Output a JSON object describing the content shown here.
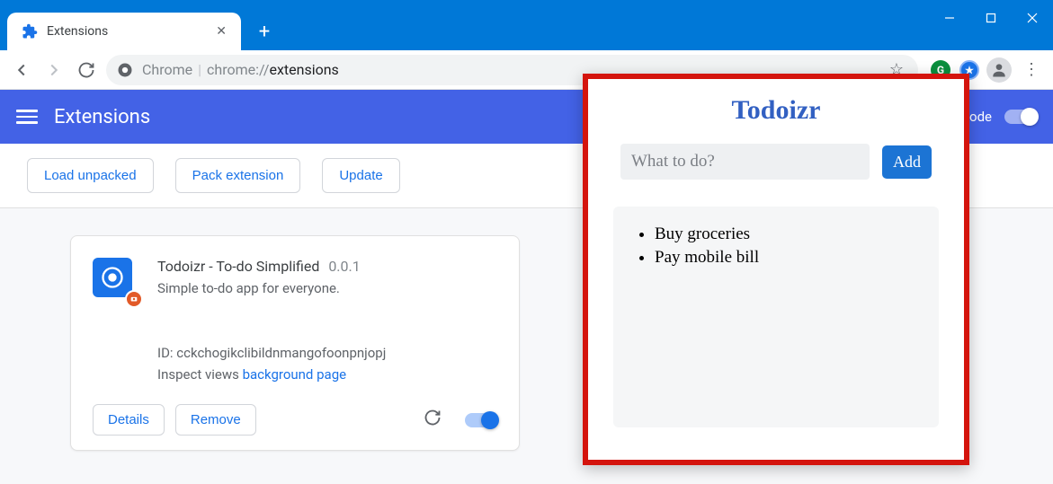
{
  "tab": {
    "title": "Extensions"
  },
  "url": {
    "prefix": "Chrome",
    "mid": "chrome://",
    "path": "extensions"
  },
  "ext_header": {
    "title": "Extensions",
    "dev_mode_label": "Developer mode"
  },
  "actions": {
    "load_unpacked": "Load unpacked",
    "pack_extension": "Pack extension",
    "update": "Update"
  },
  "card": {
    "name": "Todoizr - To-do Simplified",
    "version": "0.0.1",
    "description": "Simple to-do app for everyone.",
    "id_label": "ID:",
    "id_value": "cckchogikclibildnmangofoonpnjopj",
    "inspect_label": "Inspect views",
    "inspect_link": "background page",
    "details": "Details",
    "remove": "Remove"
  },
  "popup": {
    "title": "Todoizr",
    "input_placeholder": "What to do?",
    "add_button": "Add",
    "items": [
      "Buy groceries",
      "Pay mobile bill"
    ]
  },
  "colors": {
    "titlebar": "#0078d7",
    "header": "#4362e6",
    "accent": "#1a73e8",
    "popup_border": "#d4140d"
  }
}
